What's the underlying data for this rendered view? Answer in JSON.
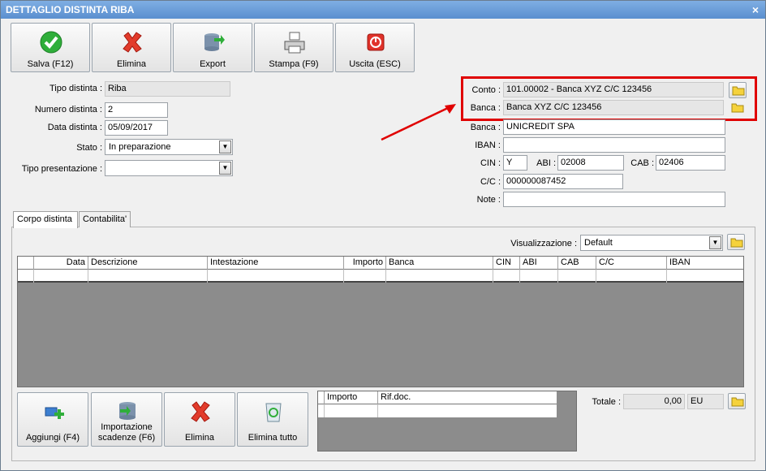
{
  "window": {
    "title": "DETTAGLIO DISTINTA RIBA",
    "close_label": "×"
  },
  "toolbar": [
    {
      "label": "Salva (F12)",
      "icon": "check-icon"
    },
    {
      "label": "Elimina",
      "icon": "delete-x-icon"
    },
    {
      "label": "Export",
      "icon": "export-db-icon"
    },
    {
      "label": "Stampa (F9)",
      "icon": "printer-icon"
    },
    {
      "label": "Uscita (ESC)",
      "icon": "exit-power-icon"
    }
  ],
  "left_form": {
    "tipo_distinta": {
      "label": "Tipo distinta :",
      "value": "Riba"
    },
    "numero_distinta": {
      "label": "Numero distinta :",
      "value": "2"
    },
    "data_distinta": {
      "label": "Data distinta :",
      "value": "05/09/2017"
    },
    "stato": {
      "label": "Stato :",
      "value": "In preparazione"
    },
    "tipo_presentazione": {
      "label": "Tipo presentazione :",
      "value": ""
    }
  },
  "right_form": {
    "conto": {
      "label": "Conto :",
      "value": "101.00002 - Banca XYZ C/C 123456"
    },
    "banca_conto": {
      "label": "Banca :",
      "value": "Banca XYZ C/C 123456"
    },
    "banca": {
      "label": "Banca :",
      "value": "UNICREDIT SPA"
    },
    "iban": {
      "label": "IBAN :",
      "value": ""
    },
    "cin": {
      "label": "CIN :",
      "value": "Y"
    },
    "abi": {
      "label": "ABI :",
      "value": "02008"
    },
    "cab": {
      "label": "CAB :",
      "value": "02406"
    },
    "cc": {
      "label": "C/C :",
      "value": "000000087452"
    },
    "note": {
      "label": "Note :",
      "value": ""
    }
  },
  "tabs": [
    {
      "label": "Corpo distinta",
      "active": true
    },
    {
      "label": "Contabilita'",
      "active": false
    }
  ],
  "view": {
    "label": "Visualizzazione :",
    "value": "Default"
  },
  "grid": {
    "columns": [
      "Data",
      "Descrizione",
      "Intestazione",
      "Importo",
      "Banca",
      "CIN",
      "ABI",
      "CAB",
      "C/C",
      "IBAN"
    ]
  },
  "bottom_buttons": [
    {
      "label": "Aggiungi (F4)",
      "icon": "add-item-icon"
    },
    {
      "label": "Importazione scadenze (F6)",
      "icon": "import-db-icon"
    },
    {
      "label": "Elimina",
      "icon": "delete-x-icon"
    },
    {
      "label": "Elimina tutto",
      "icon": "recycle-bin-icon"
    }
  ],
  "small_grid": {
    "columns": [
      "Importo",
      "Rif.doc."
    ]
  },
  "totale": {
    "label": "Totale :",
    "value": "0,00",
    "currency": "EU"
  },
  "colors": {
    "highlight": "#e00000",
    "titlebar": "#6b9cd9",
    "grid_bg": "#8c8c8c"
  }
}
